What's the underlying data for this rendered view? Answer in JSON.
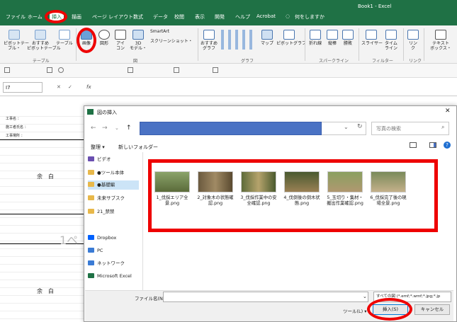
{
  "window": {
    "title": "Book1 - Excel"
  },
  "tabs": [
    "ファイル",
    "ホーム",
    "挿入",
    "描画",
    "ページ レイアウト",
    "数式",
    "データ",
    "校閲",
    "表示",
    "開発",
    "ヘルプ",
    "Acrobat",
    "何をしますか"
  ],
  "ribbon": {
    "table_group": {
      "pivot": "ピボットテー\nブル・",
      "recommended_pivot": "おすすめ\nピボットテーブル",
      "table": "テーブル",
      "label": "テーブル"
    },
    "image": "画像",
    "shapes": "図形",
    "icons": "アイ\nコン",
    "model3d": "3D\nモデル・",
    "smartart": "SmartArt",
    "screenshot": "スクリーンショット・",
    "illustration_label": "図",
    "rec_chart": "おすすめ\nグラフ",
    "map": "マップ",
    "pivot_chart": "ピボットグラフ",
    "chart_label": "グラフ",
    "line": "折れ線",
    "column": "縦棒",
    "winloss": "勝敗",
    "sparkline_label": "スパークライン",
    "slicer": "スライサー",
    "timeline": "タイム\nライン",
    "filter_label": "フィルター",
    "link": "リン\nク",
    "link_label": "リンク",
    "textbox": "テキスト\nボックス・"
  },
  "formula": {
    "namebox": "I7",
    "fx": "fx"
  },
  "sheet": {
    "row1": "工事名 ：",
    "row2": "施工者氏名 ：",
    "row3": "工事場所 ：",
    "blank1": "余　白",
    "blank2": "余　白",
    "page_ghost": "1ペ",
    "rownums": [
      "1",
      "2",
      "3",
      "4",
      "5",
      "6",
      "7",
      "8",
      "9",
      "10",
      "11",
      "12",
      "13",
      "14",
      "15",
      "16",
      "17",
      "18",
      "19",
      "20",
      "21",
      "22",
      "23",
      "24",
      "25",
      "26",
      "27"
    ]
  },
  "dialog": {
    "title": "図の挿入",
    "search_placeholder": "写真の検索",
    "organize": "整理 ▾",
    "new_folder": "新しいフォルダー",
    "nav": {
      "video": "ビデオ",
      "folder1": "●ツール本体",
      "folder2": "●基礎編",
      "folder3": "未来サブスク",
      "folder4": "21_禁禁",
      "dropbox": "Dropbox",
      "pc": "PC",
      "network": "ネットワーク",
      "excel": "Microsoft Excel"
    },
    "files": [
      {
        "name": "1_伐採エリア全景.png"
      },
      {
        "name": "2_対象木の状態確認.png"
      },
      {
        "name": "3_伐採作業中の安全確認.png"
      },
      {
        "name": "4_伐倒後の倒木状態.png"
      },
      {
        "name": "5_玉切り・集材・搬出作業確認.png"
      },
      {
        "name": "6_伐採完了後の現場全景.png"
      }
    ],
    "filename_label": "ファイル名(N):",
    "filter": "すべての図 (*.emf;*.wmf;*.jpg;*.jp",
    "tools": "ツール(L) ▾",
    "insert": "挿入(S)",
    "cancel": "キャンセル"
  },
  "colors": {
    "excel_green": "#1f7145",
    "highlight_red": "#e00000",
    "address_blue": "#4a72c4"
  }
}
